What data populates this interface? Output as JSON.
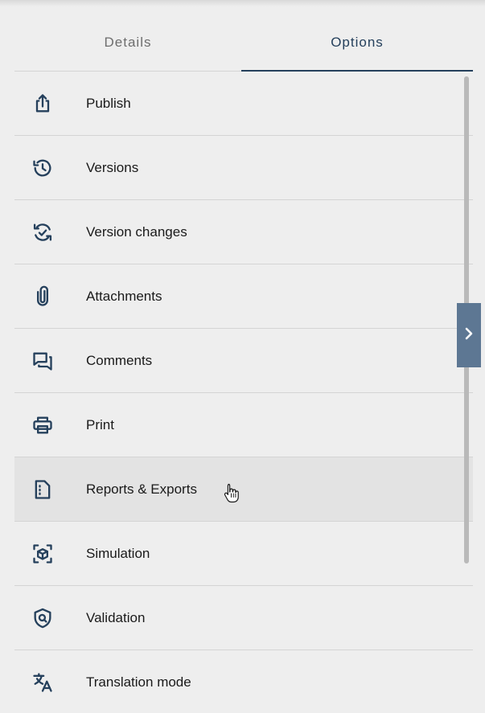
{
  "tabs": {
    "details_label": "Details",
    "options_label": "Options",
    "active": "Options"
  },
  "menu": {
    "items": [
      {
        "label": "Publish",
        "icon": "publish-icon"
      },
      {
        "label": "Versions",
        "icon": "history-icon"
      },
      {
        "label": "Version changes",
        "icon": "sync-check-icon"
      },
      {
        "label": "Attachments",
        "icon": "paperclip-icon"
      },
      {
        "label": "Comments",
        "icon": "comments-icon"
      },
      {
        "label": "Print",
        "icon": "printer-icon"
      },
      {
        "label": "Reports & Exports",
        "icon": "report-icon"
      },
      {
        "label": "Simulation",
        "icon": "cube-scan-icon"
      },
      {
        "label": "Validation",
        "icon": "shield-search-icon"
      },
      {
        "label": "Translation mode",
        "icon": "translate-icon"
      }
    ],
    "hovered_item": "Reports & Exports"
  },
  "colors": {
    "background": "#eeeeee",
    "accent": "#25405c",
    "icon": "#25405c",
    "divider": "#d4d4d4",
    "hover_row": "#e3e3e3",
    "expand_handle": "#5d7793"
  }
}
